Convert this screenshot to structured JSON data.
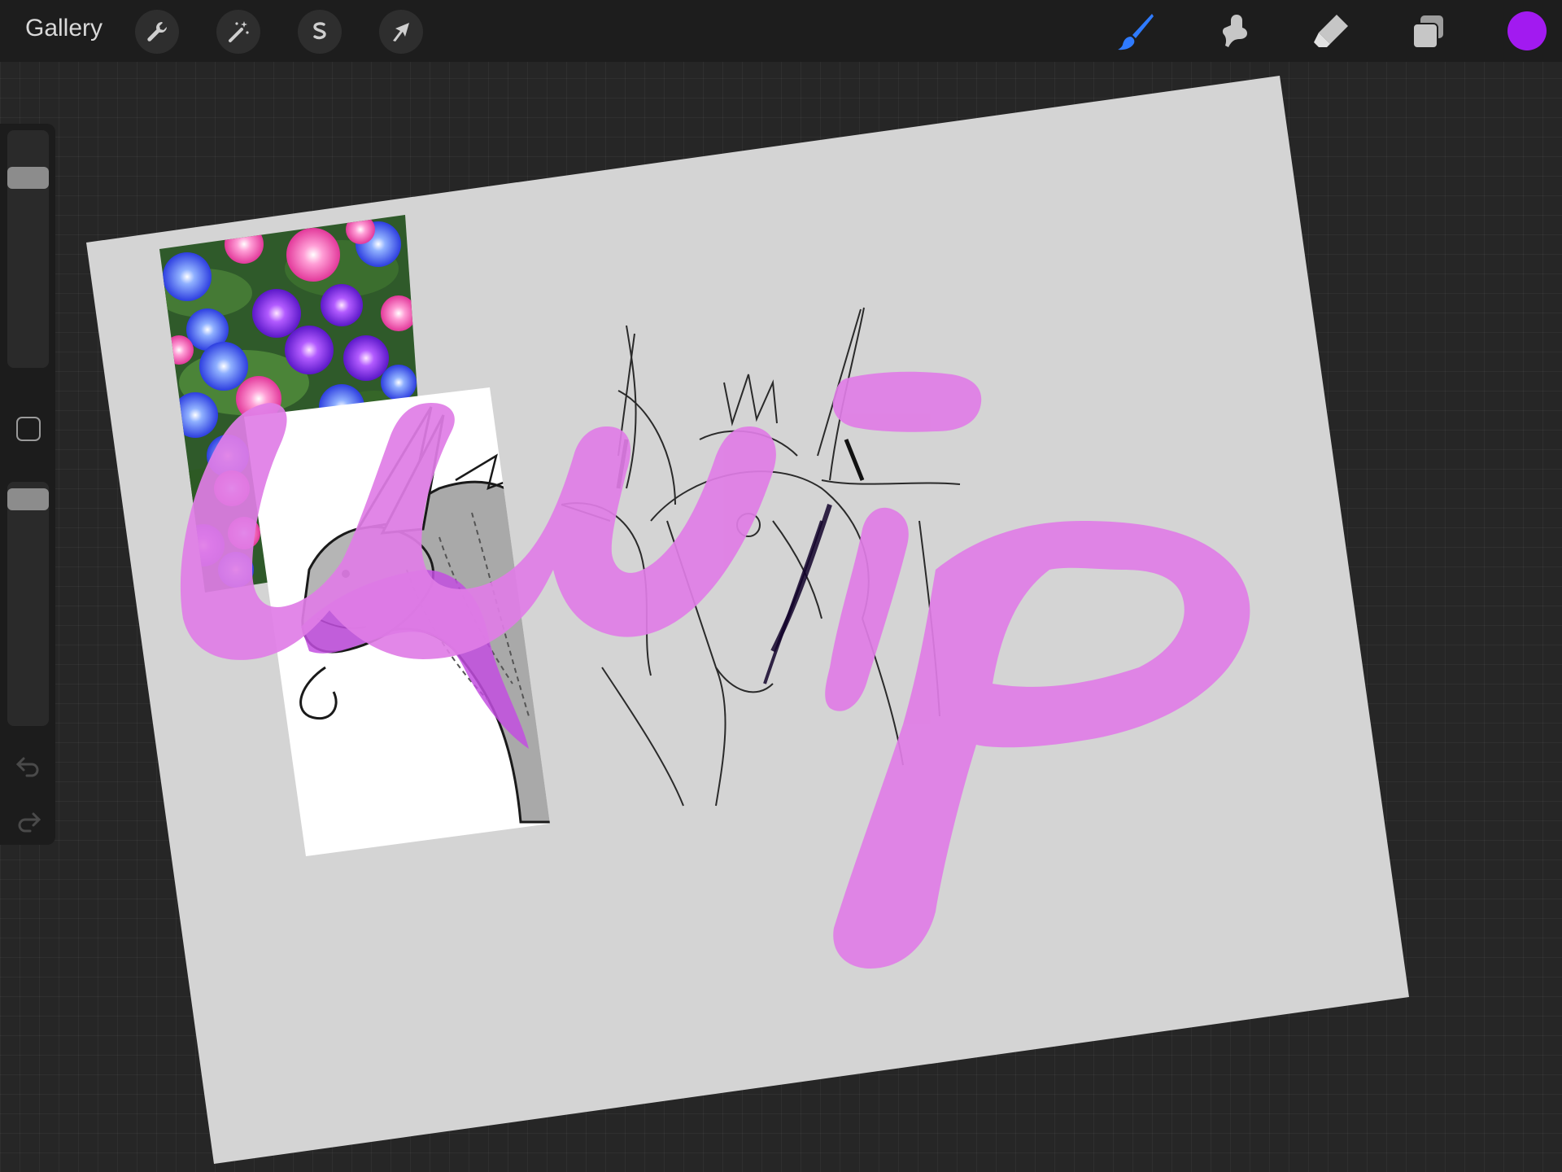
{
  "app": {
    "gallery_label": "Gallery"
  },
  "toolbar": {
    "left_tools": [
      "wrench-icon",
      "magic-wand-icon",
      "selection-icon",
      "transform-arrow-icon"
    ],
    "right_tools": [
      "brush-icon",
      "smudge-icon",
      "eraser-icon",
      "layers-icon"
    ],
    "active_tool": "brush",
    "active_color": "#a21af0",
    "brush_active_color": "#2f7bff"
  },
  "sidebar": {
    "brush_size_level": 0.15,
    "opacity_level": 0.06,
    "undo_icon": "undo-icon",
    "redo_icon": "redo-icon"
  },
  "canvas": {
    "background": "#d4d4d4",
    "lettering_color": "#e07de6",
    "elements": [
      "reference-photo-morning-glories",
      "dragon-reference-drawing",
      "dragon-sketch",
      "lettering"
    ]
  }
}
